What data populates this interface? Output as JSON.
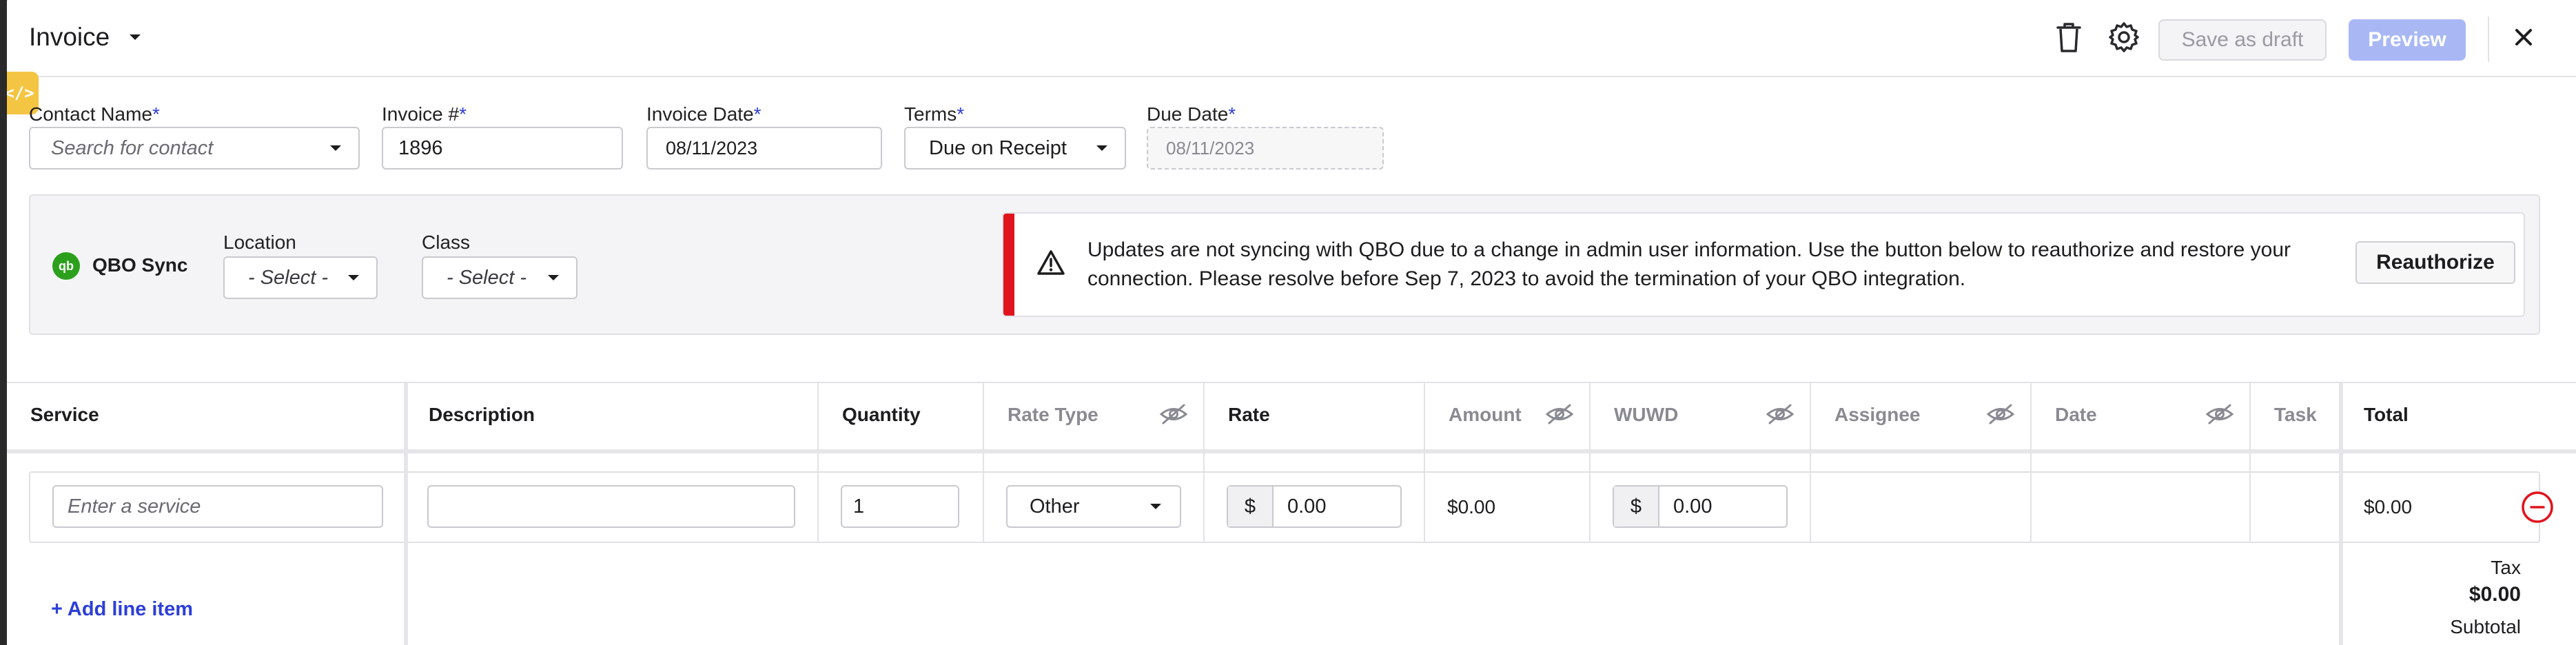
{
  "header": {
    "title": "Invoice",
    "save_draft_label": "Save as draft",
    "preview_label": "Preview",
    "icons": [
      "trash-icon",
      "gear-icon",
      "close-icon"
    ]
  },
  "dev_badge": "</>",
  "form": {
    "contact": {
      "label": "Contact Name",
      "required": "*",
      "placeholder": "Search for contact"
    },
    "invoice_number": {
      "label": "Invoice #",
      "required": "*",
      "value": "1896"
    },
    "invoice_date": {
      "label": "Invoice Date",
      "required": "*",
      "value": "08/11/2023"
    },
    "terms": {
      "label": "Terms",
      "required": "*",
      "value": "Due on Receipt"
    },
    "due_date": {
      "label": "Due Date",
      "required": "*",
      "value": "08/11/2023"
    }
  },
  "sync": {
    "logo_text": "qb",
    "title": "QBO Sync",
    "location": {
      "label": "Location",
      "value": "- Select -"
    },
    "class": {
      "label": "Class",
      "value": "- Select -"
    },
    "alert": {
      "color": "#e0141d",
      "message": "Updates are not syncing with QBO due to a change in admin user information. Use the button below to reauthorize and restore your connection. Please resolve before Sep 7, 2023 to avoid the termination of your QBO integration.",
      "button_label": "Reauthorize"
    }
  },
  "table": {
    "columns": [
      "Service",
      "Description",
      "Quantity",
      "Rate Type",
      "Rate",
      "Amount",
      "WUWD",
      "Assignee",
      "Date",
      "Task",
      "Total"
    ],
    "row": {
      "service_placeholder": "Enter a service",
      "description": "",
      "quantity": "1",
      "rate_type": "Other",
      "rate_prefix": "$",
      "rate": "0.00",
      "amount": "$0.00",
      "wuwd_prefix": "$",
      "wuwd": "0.00",
      "total": "$0.00"
    },
    "add_line_label": "+ Add line item"
  },
  "summary": {
    "tax_label": "Tax",
    "tax_value": "$0.00",
    "subtotal_label": "Subtotal"
  },
  "colors": {
    "accent": "#2d3fd8",
    "preview_disabled": "#a9b8f5",
    "alert": "#e0141d",
    "qbo": "#2ca01c"
  }
}
